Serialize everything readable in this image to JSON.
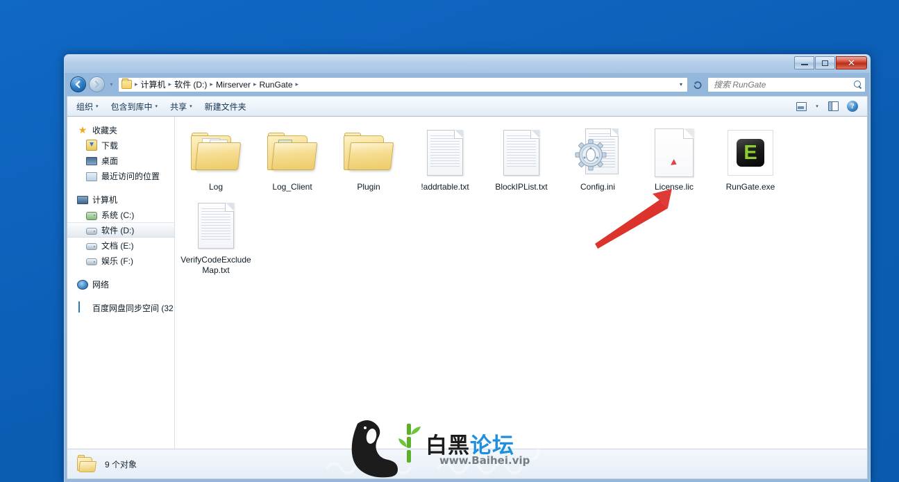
{
  "window": {
    "controls": {
      "minimize": "–",
      "maximize": "□",
      "close": "✕"
    }
  },
  "address_bar": {
    "back_label": "←",
    "forward_label": "→",
    "history_caret": "▾",
    "breadcrumbs": [
      "计算机",
      "软件 (D:)",
      "Mirserver",
      "RunGate"
    ],
    "separator": "▸",
    "dropdown_caret": "▾",
    "refresh_label": "↺"
  },
  "search": {
    "placeholder": "搜索 RunGate",
    "value": ""
  },
  "toolbar": {
    "items": [
      {
        "label": "组织",
        "caret": "▾"
      },
      {
        "label": "包含到库中",
        "caret": "▾"
      },
      {
        "label": "共享",
        "caret": "▾"
      },
      {
        "label": "新建文件夹",
        "caret": ""
      }
    ],
    "view_caret": "▾",
    "help_label": "?"
  },
  "sidebar": {
    "groups": [
      {
        "header": {
          "label": "收藏夹",
          "icon": "star-icon"
        },
        "items": [
          {
            "label": "下载",
            "icon": "download-icon",
            "selected": false
          },
          {
            "label": "桌面",
            "icon": "desktop-icon",
            "selected": false
          },
          {
            "label": "最近访问的位置",
            "icon": "recent-places-icon",
            "selected": false
          }
        ]
      },
      {
        "header": {
          "label": "计算机",
          "icon": "computer-icon"
        },
        "items": [
          {
            "label": "系统 (C:)",
            "icon": "system-drive-icon",
            "selected": false
          },
          {
            "label": "软件 (D:)",
            "icon": "drive-icon",
            "selected": true
          },
          {
            "label": "文档 (E:)",
            "icon": "drive-icon",
            "selected": false
          },
          {
            "label": "娱乐 (F:)",
            "icon": "drive-icon",
            "selected": false
          }
        ]
      },
      {
        "header": {
          "label": "网络",
          "icon": "network-icon"
        },
        "items": []
      },
      {
        "header": {
          "label": "百度网盘同步空间 (32",
          "icon": "baidu-netdisk-icon"
        },
        "items": []
      }
    ]
  },
  "files": [
    {
      "name": "Log",
      "type": "folder-with-docs"
    },
    {
      "name": "Log_Client",
      "type": "folder-with-files"
    },
    {
      "name": "Plugin",
      "type": "folder-empty"
    },
    {
      "name": "!addrtable.txt",
      "type": "text-file"
    },
    {
      "name": "BlockIPList.txt",
      "type": "text-file"
    },
    {
      "name": "Config.ini",
      "type": "ini-file"
    },
    {
      "name": "License.lic",
      "type": "generic-file"
    },
    {
      "name": "RunGate.exe",
      "type": "executable",
      "icon_letter": "E"
    },
    {
      "name": "VerifyCodeExcludeMap.txt",
      "type": "text-file"
    }
  ],
  "annotation": {
    "arrow_color": "#e03a34",
    "points_to": "License.lic"
  },
  "status_bar": {
    "text": "9 个对象"
  },
  "watermark": {
    "title_black": "白黑",
    "title_blue": "论坛",
    "url": "www.Baihei.vip"
  },
  "colors": {
    "desktop": "#0d63bd",
    "accent": "#3c86c8",
    "close_button": "#b92d19",
    "annotation_red": "#e03a34",
    "exe_green": "#8ccf2b",
    "watermark_blue": "#1f8fe0"
  }
}
